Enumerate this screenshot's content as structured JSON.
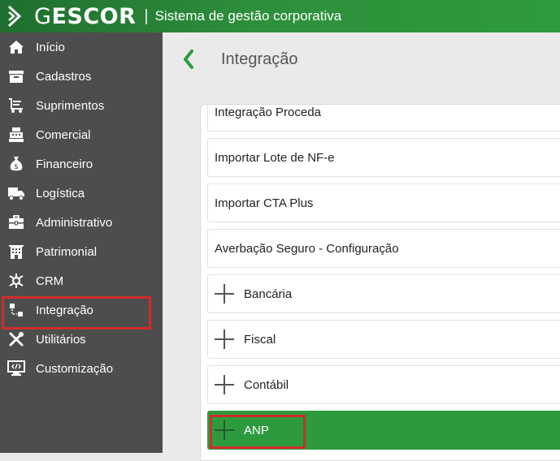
{
  "header": {
    "brand_first": "G",
    "brand_rest": "ESCOR",
    "separator": "|",
    "subtitle": "Sistema de gestão corporativa"
  },
  "sidebar": {
    "items": [
      {
        "label": "Início",
        "icon": "home-icon"
      },
      {
        "label": "Cadastros",
        "icon": "archive-icon"
      },
      {
        "label": "Suprimentos",
        "icon": "cart-icon"
      },
      {
        "label": "Comercial",
        "icon": "cash-register-icon"
      },
      {
        "label": "Financeiro",
        "icon": "money-bag-icon"
      },
      {
        "label": "Logística",
        "icon": "truck-icon"
      },
      {
        "label": "Administrativo",
        "icon": "briefcase-icon"
      },
      {
        "label": "Patrimonial",
        "icon": "building-icon"
      },
      {
        "label": "CRM",
        "icon": "network-icon"
      },
      {
        "label": "Integração",
        "icon": "integration-icon",
        "highlighted": true
      },
      {
        "label": "Utilitários",
        "icon": "tools-icon"
      },
      {
        "label": "Customização",
        "icon": "code-monitor-icon"
      }
    ]
  },
  "main": {
    "title": "Integração",
    "rows": [
      {
        "label": "Integração Proceda",
        "expandable": false
      },
      {
        "label": "Importar Lote de NF-e",
        "expandable": false
      },
      {
        "label": "Importar CTA Plus",
        "expandable": false
      },
      {
        "label": "Averbação Seguro - Configuração",
        "expandable": false
      },
      {
        "label": "Bancária",
        "expandable": true
      },
      {
        "label": "Fiscal",
        "expandable": true
      },
      {
        "label": "Contábil",
        "expandable": true
      },
      {
        "label": "ANP",
        "expandable": true,
        "active": true,
        "highlighted": true
      }
    ]
  },
  "colors": {
    "header_green": "#2d8f3b",
    "sidebar_bg": "#4d4d4d",
    "active_row": "#2e9a3f",
    "highlight": "#d12b2b"
  }
}
